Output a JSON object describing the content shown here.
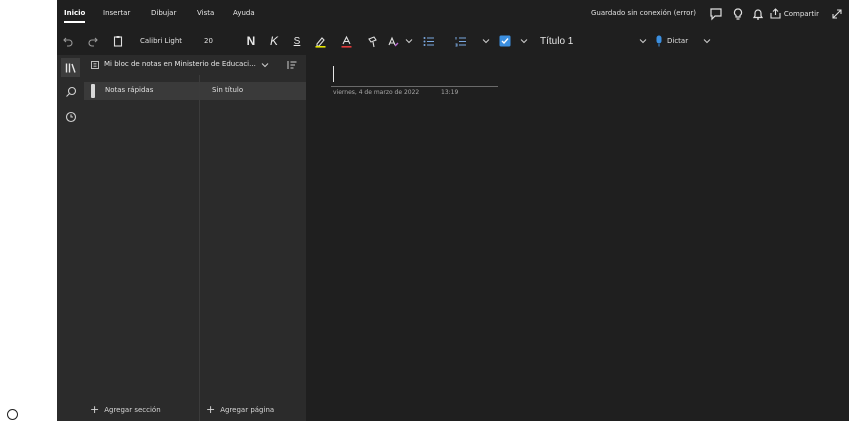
{
  "ribbon": {
    "tabs": [
      {
        "label": "Inicio"
      },
      {
        "label": "Insertar"
      },
      {
        "label": "Dibujar"
      },
      {
        "label": "Vista"
      },
      {
        "label": "Ayuda"
      }
    ],
    "status_text": "Guardado sin conexión (error)",
    "share_label": "Compartir"
  },
  "toolbar": {
    "font_name": "Calibri Light",
    "font_size": "20",
    "bold_label": "N",
    "italic_label": "K",
    "underline_label": "S",
    "underline_color": "#e6e600",
    "font_color_bar": "#e23b3b",
    "style_value": "Título 1",
    "dictate_label": "Dictar",
    "dictate_icon_color": "#3b8fe0",
    "todo_check_color": "#ffffff"
  },
  "notebook": {
    "title": "Mi bloc de notas en Ministerio de Educaci...",
    "sections": [
      {
        "label": "Notas rápidas"
      }
    ],
    "pages": [
      {
        "label": "Sin título"
      }
    ],
    "add_section_label": "Agregar sección",
    "add_page_label": "Agregar página"
  },
  "page": {
    "date": "viernes, 4 de marzo de 2022",
    "time": "13:19"
  },
  "icons": {
    "undo": "undo-icon",
    "redo": "redo-icon",
    "clipboard": "clipboard-icon",
    "highlighter": "highlighter-icon",
    "font_color": "font-color-icon",
    "format_painter": "format-painter-icon",
    "styles": "text-styles-icon",
    "bullets": "bullet-list-icon",
    "numbering": "numbered-list-icon",
    "todo": "todo-checkbox-icon",
    "mic": "microphone-icon",
    "notebooks": "notebooks-icon",
    "search": "search-icon",
    "recent": "clock-icon",
    "sort": "sort-icon",
    "feedback": "feedback-icon",
    "lightbulb": "lightbulb-icon",
    "bell": "bell-icon",
    "share": "share-icon",
    "expand": "expand-icon"
  }
}
